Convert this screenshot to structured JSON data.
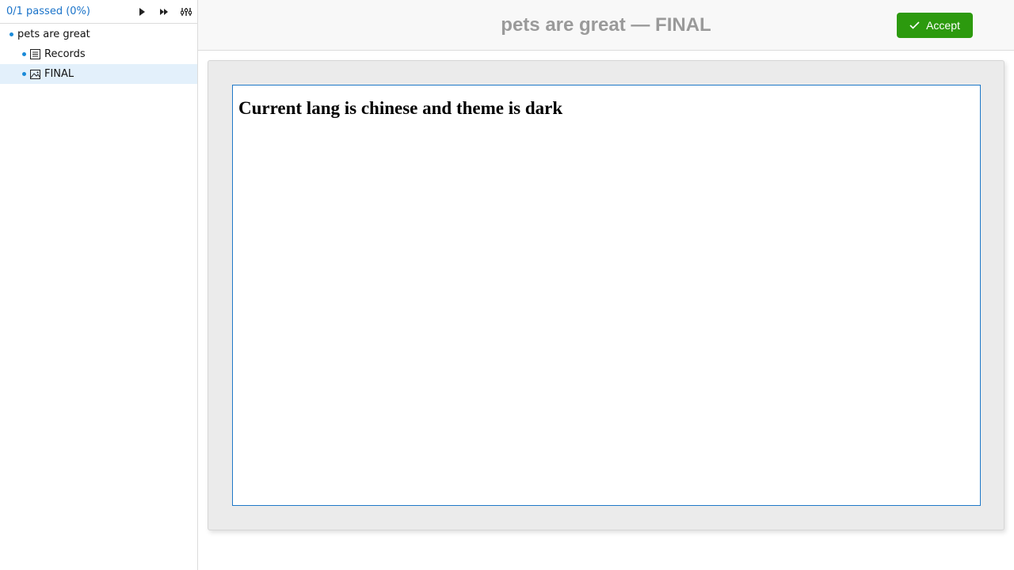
{
  "sidebar": {
    "status": "0/1 passed (0%)",
    "toolbar": {
      "run_icon": "play-icon",
      "run_all_icon": "fast-forward-icon",
      "settings_icon": "sliders-icon"
    },
    "tree": {
      "root": {
        "label": "pets are great"
      },
      "children": [
        {
          "label": "Records",
          "icon": "list-icon"
        },
        {
          "label": "FINAL",
          "icon": "image-icon",
          "selected": true
        }
      ]
    }
  },
  "main": {
    "title": "pets are great — FINAL",
    "accept_label": "Accept",
    "preview": {
      "heading": "Current lang is chinese and theme is dark"
    }
  },
  "colors": {
    "accent": "#1a73c9",
    "accept": "#2c9a0e",
    "selected_bg": "#e3f0fb"
  }
}
